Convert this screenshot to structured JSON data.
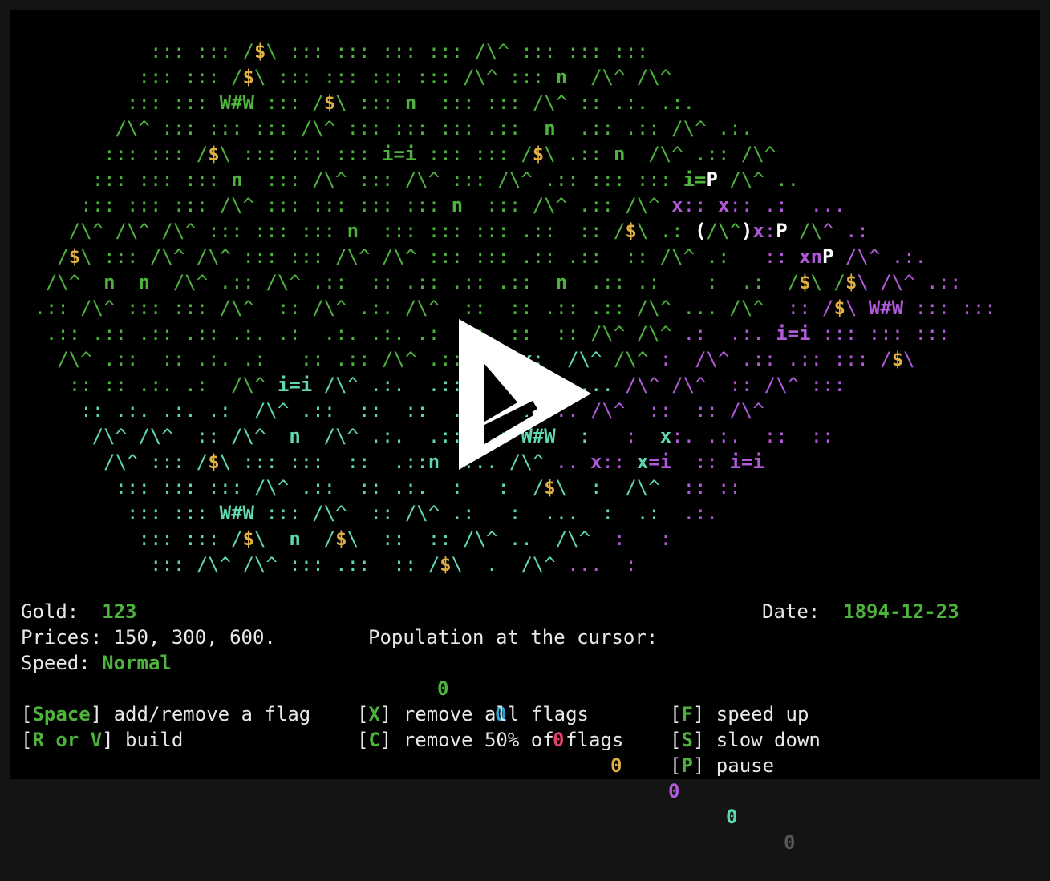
{
  "map": {
    "rows": [
      [
        [
          11,
          ""
        ],
        [
          14,
          "::: ::: /",
          "g"
        ],
        [
          1,
          "$",
          "yb"
        ],
        [
          2,
          "\\ ",
          "g"
        ],
        [
          32,
          "::: ::: ::: ::: /\\^ ::: ::: :::",
          "g"
        ]
      ],
      [
        [
          10,
          ""
        ],
        [
          14,
          "::: ::: /",
          "g"
        ],
        [
          1,
          "$",
          "yb"
        ],
        [
          2,
          "\\ ",
          "g"
        ],
        [
          19,
          "::: ::: ::: ::: /\\",
          "g"
        ],
        [
          3,
          "^ :",
          "g"
        ],
        [
          4,
          ":: ",
          "g"
        ],
        [
          1,
          "n",
          "gb"
        ],
        [
          2,
          "  ",
          "g"
        ],
        [
          8,
          "/\\^ /\\^",
          "g"
        ]
      ],
      [
        [
          9,
          ""
        ],
        [
          8,
          "::: ::: ",
          "g"
        ],
        [
          3,
          "W#W",
          "gb"
        ],
        [
          7,
          " ::: /",
          "g"
        ],
        [
          1,
          "$",
          "yb"
        ],
        [
          2,
          "\\ ",
          "g"
        ],
        [
          6,
          "::: ",
          "g"
        ],
        [
          1,
          "n",
          "gb"
        ],
        [
          2,
          "  ",
          "g"
        ],
        [
          12,
          "::: ::: /\\^ ",
          "g"
        ],
        [
          3,
          ":: ",
          "g"
        ],
        [
          8,
          ".:. .:.",
          "g"
        ]
      ],
      [
        [
          8,
          ""
        ],
        [
          40,
          "/\\^ ::: ::: ::: /\\^ ::: ::: ::: .::  ",
          "g"
        ],
        [
          1,
          "n",
          "gb"
        ],
        [
          14,
          "  .:: .:: /\\^ ",
          "g"
        ],
        [
          3,
          ".:.",
          "g"
        ]
      ],
      [
        [
          7,
          ""
        ],
        [
          11,
          "::: ::: /",
          "g"
        ],
        [
          1,
          "$",
          "yb"
        ],
        [
          2,
          "\\ ",
          "g"
        ],
        [
          14,
          "::: ::: ::: ",
          "g"
        ],
        [
          3,
          "i=i",
          "gb"
        ],
        [
          9,
          " ::: ::: ",
          "g"
        ],
        [
          1,
          "/",
          "g"
        ],
        [
          1,
          "$",
          "yb"
        ],
        [
          2,
          "\\ ",
          "g"
        ],
        [
          4,
          ".:: ",
          "g"
        ],
        [
          1,
          "n",
          "gb"
        ],
        [
          2,
          "  ",
          "g"
        ],
        [
          17,
          "/\\^ .:: /\\^",
          "g"
        ]
      ],
      [
        [
          6,
          ""
        ],
        [
          12,
          "::: ::: ::: ",
          "g"
        ],
        [
          1,
          "n",
          "gb"
        ],
        [
          2,
          "  ",
          "g"
        ],
        [
          39,
          "::: /\\^ ::: /\\^ ::: /\\^ .:: ::: ::: ",
          "g"
        ],
        [
          2,
          "i=",
          "gb"
        ],
        [
          1,
          "P",
          "w"
        ],
        [
          7,
          " /\\^ ..",
          "g"
        ]
      ],
      [
        [
          5,
          ""
        ],
        [
          16,
          "::: ::: ::: /\\^ ",
          "g"
        ],
        [
          16,
          "::: ::: ::: ::: ",
          "g"
        ],
        [
          1,
          "n",
          "gb"
        ],
        [
          2,
          "  ",
          "g"
        ],
        [
          9,
          "::: /\\^ ",
          "g"
        ],
        [
          9,
          ".:: /\\^ ",
          "g"
        ],
        [
          1,
          "x",
          "mb"
        ],
        [
          3,
          ":: ",
          "m"
        ],
        [
          1,
          "x",
          "mb"
        ],
        [
          3,
          ":: ",
          "m"
        ],
        [
          6,
          ".:  ...",
          "m"
        ]
      ],
      [
        [
          4,
          ""
        ],
        [
          16,
          "/\\^ /\\^ /\\^ ::: ",
          "g"
        ],
        [
          8,
          "::: ::: ",
          "g"
        ],
        [
          1,
          "n",
          "gb"
        ],
        [
          2,
          "  ",
          "g"
        ],
        [
          20,
          "::: ::: ::: .::  :: ",
          "g"
        ],
        [
          1,
          "/",
          "g"
        ],
        [
          1,
          "$",
          "yb"
        ],
        [
          5,
          "\\ .: ",
          "g"
        ],
        [
          1,
          "(",
          "w"
        ],
        [
          3,
          "/\\^",
          "g"
        ],
        [
          1,
          ")",
          "w"
        ],
        [
          1,
          "x",
          "mb"
        ],
        [
          1,
          ":",
          "m"
        ],
        [
          1,
          "P",
          "w"
        ],
        [
          3,
          " /\\",
          "g"
        ],
        [
          5,
          "^ .:",
          "m"
        ]
      ],
      [
        [
          3,
          ""
        ],
        [
          1,
          "/",
          "g"
        ],
        [
          1,
          "$",
          "yb"
        ],
        [
          44,
          "\\ ::: /\\^ /\\^ ::: ::: /\\^ /\\^ ::: ::: .:: .::  :: /\\^ .:   ",
          "g"
        ],
        [
          3,
          ":: ",
          "m"
        ],
        [
          2,
          "xn",
          "mb"
        ],
        [
          1,
          "P",
          "w"
        ],
        [
          11,
          " /\\^ .:.",
          "m"
        ]
      ],
      [
        [
          2,
          ""
        ],
        [
          4,
          "/\\^  ",
          "g"
        ],
        [
          1,
          "n",
          "gb"
        ],
        [
          3,
          "  ",
          "g"
        ],
        [
          1,
          "n",
          "gb"
        ],
        [
          42,
          "  /\\^ .:: /\\^ .::  :: .:: .:: .::  ",
          "g"
        ],
        [
          1,
          "n",
          "gb"
        ],
        [
          26,
          "  .:: .:    :  .:  /",
          "g"
        ],
        [
          1,
          "$",
          "yb"
        ],
        [
          3,
          "\\ /",
          "g"
        ],
        [
          1,
          "$",
          "yb"
        ],
        [
          12,
          "\\ /\\^ .::",
          "m"
        ]
      ],
      [
        [
          1,
          ""
        ],
        [
          58,
          ".:: /\\^ ::: ::: /\\^  :: /\\^ .:. /\\^  ::  :: .:: .:: /\\^ ... /\\^  ",
          "g"
        ],
        [
          4,
          ":: /",
          "m"
        ],
        [
          1,
          "$",
          "yb"
        ],
        [
          2,
          "\\ ",
          "m"
        ],
        [
          3,
          "W#W",
          "mb"
        ],
        [
          8,
          " ::: :::",
          "m"
        ]
      ],
      [
        [
          2,
          ""
        ],
        [
          52,
          ".:: .:: .:: .:: .:. .:  .:. .:. .:  .:  ::  :: /\\^ /\\^ ",
          "g"
        ],
        [
          8,
          ".:  .:. ",
          "m"
        ],
        [
          3,
          "i=i",
          "mb"
        ],
        [
          12,
          " ::: ::: :::",
          "m"
        ]
      ],
      [
        [
          3,
          ""
        ],
        [
          42,
          "/\\^ .::  :: .:. .:   :: .:: /\\^ .:: .:: ",
          "g"
        ],
        [
          1,
          "x",
          "cb"
        ],
        [
          8,
          ":  /\\^ ",
          "c"
        ],
        [
          5,
          "/\\^ ",
          "g"
        ],
        [
          8,
          ":  /\\^ ",
          "m"
        ],
        [
          12,
          ".:: .:: ::: ",
          "m"
        ],
        [
          1,
          "/",
          "m"
        ],
        [
          1,
          "$",
          "yb"
        ],
        [
          1,
          "\\",
          "m"
        ]
      ],
      [
        [
          4,
          ""
        ],
        [
          13,
          ":: :: .:. .:  ",
          "g"
        ],
        [
          6,
          "/\\^ ",
          "g"
        ],
        [
          3,
          "i=i",
          "cb"
        ],
        [
          10,
          " /\\^ .:.",
          "c"
        ],
        [
          23,
          "  .:: .:.   .  ... ",
          "c"
        ],
        [
          20,
          "/\\^ /\\^  :: /\\^ :::",
          "m"
        ]
      ],
      [
        [
          5,
          ""
        ],
        [
          10,
          ":: .:. .:. ",
          "c"
        ],
        [
          9,
          ".:  /\\^ ",
          "c"
        ],
        [
          20,
          ".::  ::  ::  ... ... ",
          "c"
        ],
        [
          24,
          "... /\\^  ::  :: /\\^",
          "m"
        ]
      ],
      [
        [
          6,
          ""
        ],
        [
          9,
          "/\\^ /\\^ ",
          "c"
        ],
        [
          9,
          " :: /\\^  ",
          "c"
        ],
        [
          1,
          "n",
          "cb"
        ],
        [
          10,
          "  /\\^ .:.",
          "c"
        ],
        [
          10,
          "  .::  .: ",
          "c"
        ],
        [
          3,
          "W#W",
          "cb"
        ],
        [
          5,
          "  :  ",
          "c"
        ],
        [
          5,
          " :  ",
          "m"
        ],
        [
          1,
          "x",
          "cb"
        ],
        [
          14,
          ":. .:.  ::  ::",
          "m"
        ]
      ],
      [
        [
          7,
          ""
        ],
        [
          4,
          "/\\^ ",
          "c"
        ],
        [
          8,
          "::: /",
          "c"
        ],
        [
          1,
          "$",
          "yb"
        ],
        [
          8,
          "\\ ::: ::",
          "c"
        ],
        [
          10,
          ":  ::  .::",
          "c"
        ],
        [
          1,
          "n",
          "cb"
        ],
        [
          9,
          "  ... /\\^",
          "c"
        ],
        [
          4,
          " .. ",
          "m"
        ],
        [
          1,
          "x",
          "mb"
        ],
        [
          4,
          ":: ",
          "m"
        ],
        [
          1,
          "x",
          "cb"
        ],
        [
          2,
          "=i",
          "mb"
        ],
        [
          4,
          "  ::",
          "m"
        ],
        [
          1,
          " ",
          "m"
        ],
        [
          3,
          "i=i",
          "mb"
        ]
      ],
      [
        [
          8,
          ""
        ],
        [
          20,
          "::: ::: ::: /\\^ .:: ",
          "c"
        ],
        [
          16,
          " :: .:.  :   :  ",
          "c"
        ],
        [
          1,
          "/",
          "c"
        ],
        [
          1,
          "$",
          "yb"
        ],
        [
          11,
          "\\  :  /\\^  ",
          "c"
        ],
        [
          8,
          ":: ::",
          "m"
        ]
      ],
      [
        [
          9,
          ""
        ],
        [
          8,
          "::: ::: ",
          "c"
        ],
        [
          3,
          "W#W",
          "cb"
        ],
        [
          13,
          " ::: /\\^  :: ",
          "c"
        ],
        [
          10,
          "/\\^ .:   ",
          "c"
        ],
        [
          14,
          ":  ...  :  .:",
          "c"
        ],
        [
          4,
          "  .:.",
          "m"
        ]
      ],
      [
        [
          10,
          ""
        ],
        [
          9,
          "::: ::: /",
          "c"
        ],
        [
          1,
          "$",
          "yb"
        ],
        [
          3,
          "\\  ",
          "c"
        ],
        [
          1,
          "n",
          "cb"
        ],
        [
          3,
          "  /",
          "c"
        ],
        [
          1,
          "$",
          "yb"
        ],
        [
          22,
          "\\  ::  :: /\\^ ..  /\\^",
          "c"
        ],
        [
          10,
          "  :   :",
          "m"
        ]
      ],
      [
        [
          11,
          ""
        ],
        [
          12,
          "::: /\\^ /\\^ ",
          "c"
        ],
        [
          16,
          "::: .::  :: /",
          "c"
        ],
        [
          1,
          "$",
          "yb"
        ],
        [
          11,
          "\\  .  /\\^ ",
          "c"
        ],
        [
          8,
          "...  :",
          "m"
        ]
      ]
    ]
  },
  "hud": {
    "gold_label": "Gold:  ",
    "gold_value": "123",
    "date_label": "Date:  ",
    "date_value": "1894-12-23",
    "prices_text": "Prices: 150, 300, 600.",
    "population_label": "Population at the cursor:",
    "speed_label": "Speed: ",
    "speed_value": "Normal",
    "population": [
      {
        "value": "0",
        "color": "#4db33d"
      },
      {
        "value": "0",
        "color": "#2aa8d8"
      },
      {
        "value": "0",
        "color": "#e0406a"
      },
      {
        "value": "0",
        "color": "#e0b040"
      },
      {
        "value": "0",
        "color": "#b05ad8"
      },
      {
        "value": "0",
        "color": "#5fd7b0"
      },
      {
        "value": "0",
        "color": "#555555"
      }
    ]
  },
  "help": [
    {
      "key": "Space",
      "text": "] add/remove a flag"
    },
    {
      "key": "R or V",
      "text": "] build"
    },
    {
      "key": "X",
      "text": "] remove all flags"
    },
    {
      "key": "C",
      "text": "] remove 50% of flags"
    },
    {
      "key": "F",
      "text": "] speed up"
    },
    {
      "key": "S",
      "text": "] slow down"
    },
    {
      "key": "P",
      "text": "] pause"
    }
  ],
  "overlay": {
    "icon": "play-icon"
  }
}
